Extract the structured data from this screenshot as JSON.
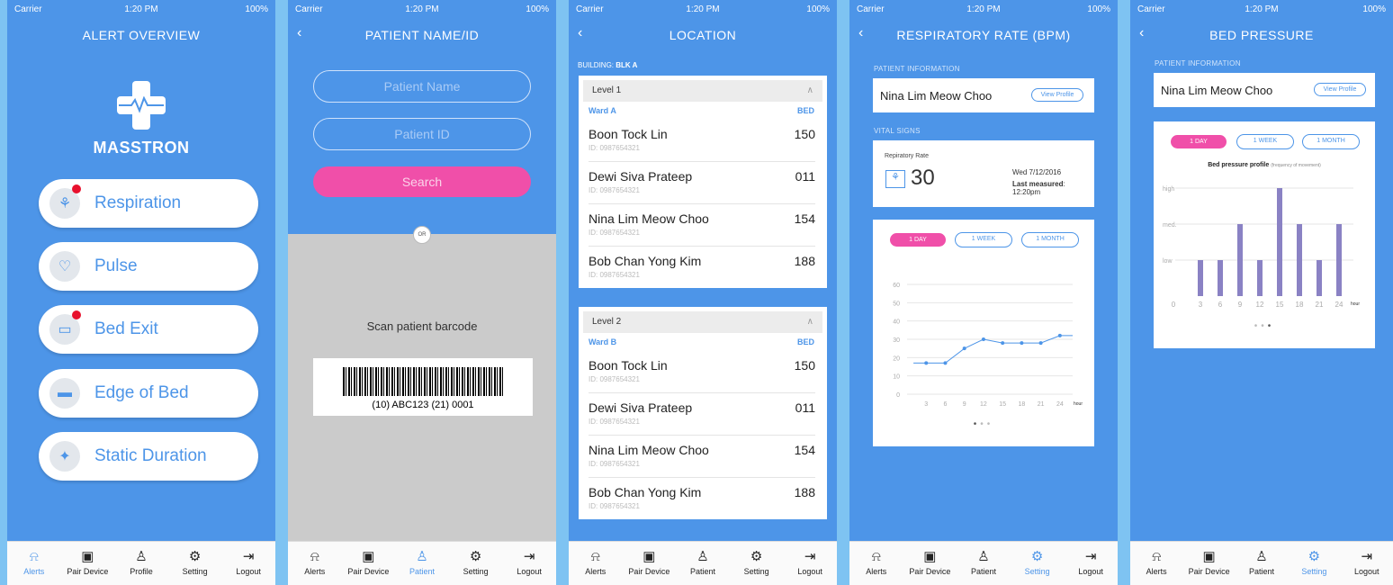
{
  "status": {
    "carrier": "Carrier",
    "time": "1:20 PM",
    "battery": "100%"
  },
  "screen1": {
    "title": "ALERT OVERVIEW",
    "brand": "MASSTRON",
    "items": [
      {
        "label": "Respiration",
        "icon": "lungs-icon",
        "alert": true
      },
      {
        "label": "Pulse",
        "icon": "heartbeat-icon",
        "alert": false
      },
      {
        "label": "Bed Exit",
        "icon": "bed-icon",
        "alert": true
      },
      {
        "label": "Edge of Bed",
        "icon": "edge-of-bed-icon",
        "alert": false
      },
      {
        "label": "Static Duration",
        "icon": "static-duration-icon",
        "alert": false
      }
    ]
  },
  "screen2": {
    "title": "PATIENT NAME/ID",
    "name_placeholder": "Patient Name",
    "id_placeholder": "Patient ID",
    "search_label": "Search",
    "or_label": "OR",
    "scan_label": "Scan patient barcode",
    "barcode_text": "(10) ABC123 (21) 0001"
  },
  "screen3": {
    "title": "LOCATION",
    "building_prefix": "BUILDING:",
    "building": "BLK A",
    "bed_header": "BED",
    "levels": [
      {
        "level": "Level 1",
        "ward": "Ward A",
        "patients": [
          {
            "name": "Boon Tock Lin",
            "id": "ID: 0987654321",
            "bed": "150"
          },
          {
            "name": "Dewi Siva Prateep",
            "id": "ID: 0987654321",
            "bed": "011"
          },
          {
            "name": "Nina Lim Meow Choo",
            "id": "ID: 0987654321",
            "bed": "154"
          },
          {
            "name": "Bob Chan Yong Kim",
            "id": "ID: 0987654321",
            "bed": "188"
          }
        ]
      },
      {
        "level": "Level 2",
        "ward": "Ward B",
        "patients": [
          {
            "name": "Boon Tock Lin",
            "id": "ID: 0987654321",
            "bed": "150"
          },
          {
            "name": "Dewi Siva Prateep",
            "id": "ID: 0987654321",
            "bed": "011"
          },
          {
            "name": "Nina Lim Meow Choo",
            "id": "ID: 0987654321",
            "bed": "154"
          },
          {
            "name": "Bob Chan Yong Kim",
            "id": "ID: 0987654321",
            "bed": "188"
          }
        ]
      }
    ]
  },
  "screen4": {
    "title": "RESPIRATORY RATE (BPM)",
    "patient_info_label": "PATIENT  INFORMATION",
    "patient_name": "Nina Lim Meow Choo",
    "view_profile": "View Profile",
    "vital_signs_label": "VITAL SIGNS",
    "rate_label": "Repiratory Rate",
    "rate_value": "30",
    "date": "Wed 7/12/2016",
    "last_measured_label": "Last measured",
    "last_measured_time": ": 12:20pm",
    "ranges": [
      "1 DAY",
      "1 WEEK",
      "1 MONTH"
    ]
  },
  "screen5": {
    "title": "BED PRESSURE",
    "patient_info_label": "PATIENT  INFORMATION",
    "patient_name": "Nina Lim Meow Choo",
    "view_profile": "View Profile",
    "ranges": [
      "1 DAY",
      "1 WEEK",
      "1 MONTH"
    ],
    "chart_title": "Bed pressure profile",
    "chart_subtitle": "(frequency of movement)"
  },
  "tabs": {
    "alerts": "Alerts",
    "pair": "Pair Device",
    "profile": "Profile",
    "patient": "Patient",
    "setting": "Setting",
    "logout": "Logout"
  },
  "chart_data": [
    {
      "type": "line",
      "x": [
        1,
        3,
        6,
        9,
        12,
        15,
        18,
        21,
        24,
        26
      ],
      "y": [
        17,
        17,
        17,
        25,
        30,
        28,
        28,
        28,
        32,
        32
      ],
      "xticks": [
        3,
        6,
        9,
        12,
        15,
        18,
        21,
        24
      ],
      "yticks": [
        0,
        10,
        20,
        30,
        40,
        50,
        60
      ],
      "xunit": "hour",
      "ylim": [
        0,
        60
      ],
      "grid": true,
      "color": "#4d95e8"
    },
    {
      "type": "bar",
      "categories": [
        3,
        4.5,
        6,
        7.5,
        9,
        10.5,
        12,
        13.5,
        15,
        16.5,
        18,
        19.5,
        21,
        22.5,
        24
      ],
      "values": [
        1,
        null,
        1,
        null,
        2,
        null,
        1,
        null,
        3,
        null,
        2,
        null,
        1,
        null,
        2
      ],
      "xticks": [
        0,
        3,
        6,
        9,
        12,
        15,
        18,
        21,
        24
      ],
      "ytick_labels": [
        "low",
        "med.",
        "high"
      ],
      "xunit": "hour",
      "ylim": [
        0,
        3
      ],
      "grid": true,
      "color": "#8a82c4"
    }
  ]
}
